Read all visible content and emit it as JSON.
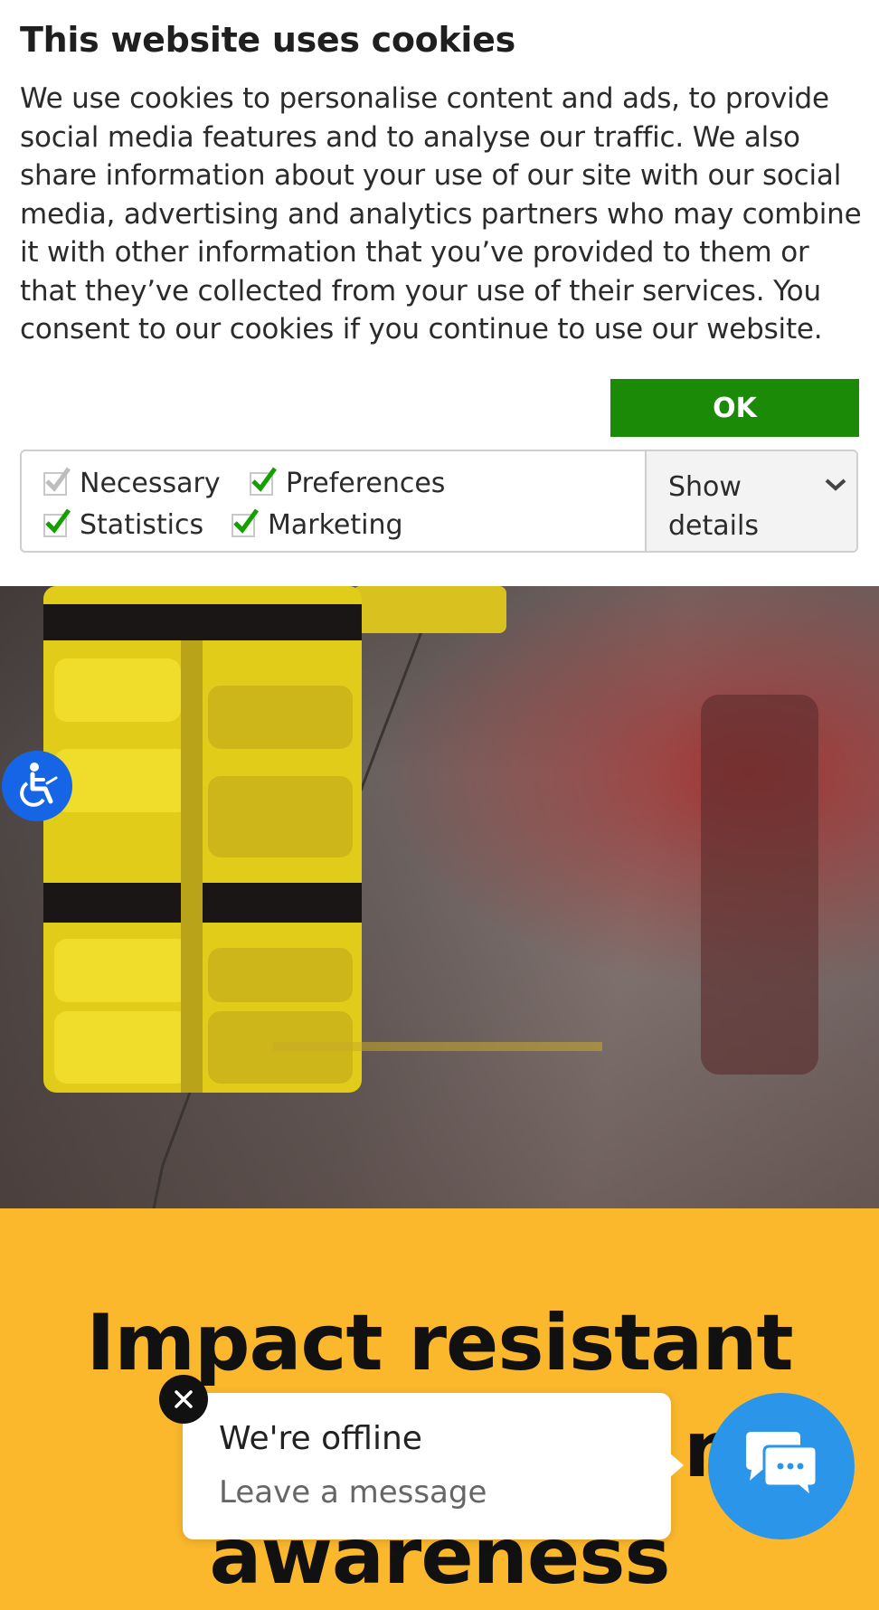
{
  "cookie": {
    "title": "This website uses cookies",
    "text": "We use cookies to personalise content and ads, to provide social media features and to analyse our traffic. We also share information about your use of our site with our social media, advertising and analytics partners who may combine it with other information that you’ve provided to them or that they’ve collected from your use of their services. You consent to our cookies if you continue to use our website.",
    "ok_label": "OK",
    "checkboxes": [
      {
        "label": "Necessary",
        "checked": true,
        "disabled": true
      },
      {
        "label": "Preferences",
        "checked": true
      },
      {
        "label": "Statistics",
        "checked": true
      },
      {
        "label": "Marketing",
        "checked": true
      }
    ],
    "show_details_label": "Show details",
    "ok_color": "#1b8a07",
    "check_color": "#14a000"
  },
  "hero": {
    "headline_line1": "Impact resistant",
    "headline_line2": "n",
    "headline_line3": "awareness",
    "background_color": "#fbb82c"
  },
  "chat": {
    "status": "We're offline",
    "prompt": "Leave a message",
    "launcher_color": "#2b95ea"
  },
  "accessibility": {
    "button_color": "#1565e6",
    "icon": "wheelchair-icon"
  }
}
